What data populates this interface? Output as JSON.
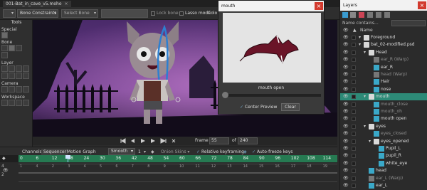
{
  "document_tab": {
    "title": "001-Bat_in_cave_v5.moho",
    "close": "×"
  },
  "toolbar": {
    "bone_constraints": "Bone Constraints",
    "select_bone": "Select Bone",
    "lock_bone": "Lock bone",
    "lasso_mode": "Lasso mode",
    "color_label": "Colo"
  },
  "tools": {
    "title": "Tools",
    "sections": [
      "Special",
      "Bone",
      "Layer",
      "Camera",
      "Workspace"
    ]
  },
  "preview_window": {
    "title": "mouth",
    "close": "×",
    "caption": "mouth open",
    "center_preview": "Center Preview",
    "clear": "Clear"
  },
  "playbar": {
    "frame_label": "Frame",
    "frame_value": "55",
    "of_label": "of",
    "total_frames": "240"
  },
  "timeline": {
    "tabs": [
      "Channels",
      "Sequencer",
      "Motion Graph"
    ],
    "interp": "Smooth",
    "step": "1",
    "onion_skins": "Onion Skins",
    "relative_keyframing": "Relative keyframing",
    "auto_freeze": "Auto-freeze keys",
    "ruler_ticks": [
      "0",
      "6",
      "12",
      "18",
      "24",
      "30",
      "36",
      "42",
      "48",
      "54",
      "60",
      "66",
      "72",
      "78",
      "84",
      "90",
      "96",
      "102",
      "108",
      "114"
    ],
    "body_ticks": [
      "1",
      "4",
      "2",
      "3",
      "4",
      "5",
      "6",
      "7",
      "8",
      "9",
      "10",
      "11",
      "12",
      "13",
      "14",
      "15",
      "16",
      "17",
      "18",
      "19"
    ],
    "row_labels": [
      "4",
      "2"
    ]
  },
  "layers": {
    "title": "Layers",
    "close": "×",
    "search_placeholder": "Name contains...",
    "name_header": "Name",
    "rows": [
      {
        "label": "Foreground",
        "indent": 0,
        "icon": "folder",
        "dim": false,
        "selected": false
      },
      {
        "label": "bat_02-modified.psd",
        "indent": 0,
        "icon": "folder",
        "dim": false,
        "selected": false
      },
      {
        "label": "Head",
        "indent": 1,
        "icon": "folder",
        "dim": false,
        "selected": false
      },
      {
        "label": "ear_R (Warp)",
        "indent": 2,
        "icon": "grp",
        "dim": true,
        "selected": false
      },
      {
        "label": "ear_R",
        "indent": 2,
        "icon": "img",
        "dim": false,
        "selected": false
      },
      {
        "label": "head (Warp)",
        "indent": 2,
        "icon": "grp",
        "dim": true,
        "selected": false
      },
      {
        "label": "Hair",
        "indent": 2,
        "icon": "img",
        "dim": false,
        "selected": false
      },
      {
        "label": "nose",
        "indent": 2,
        "icon": "img",
        "dim": false,
        "selected": false
      },
      {
        "label": "mouth",
        "indent": 1,
        "icon": "folder",
        "dim": false,
        "selected": true
      },
      {
        "label": "mouth_close",
        "indent": 2,
        "icon": "img",
        "dim": true,
        "selected": false
      },
      {
        "label": "mouth_oh",
        "indent": 2,
        "icon": "img",
        "dim": true,
        "selected": false
      },
      {
        "label": "mouth open",
        "indent": 2,
        "icon": "img",
        "dim": false,
        "selected": false
      },
      {
        "label": "eyes",
        "indent": 1,
        "icon": "folder",
        "dim": false,
        "selected": false
      },
      {
        "label": "eyes_closed",
        "indent": 2,
        "icon": "img",
        "dim": true,
        "selected": false
      },
      {
        "label": "eyes_opened",
        "indent": 2,
        "icon": "folder",
        "dim": false,
        "selected": false
      },
      {
        "label": "Pupil_L",
        "indent": 3,
        "icon": "img",
        "dim": false,
        "selected": false
      },
      {
        "label": "pupil_R",
        "indent": 3,
        "icon": "img",
        "dim": false,
        "selected": false
      },
      {
        "label": "white_eye",
        "indent": 3,
        "icon": "img",
        "dim": false,
        "selected": false
      },
      {
        "label": "head",
        "indent": 1,
        "icon": "img",
        "dim": false,
        "selected": false
      },
      {
        "label": "ear_L (Warp)",
        "indent": 1,
        "icon": "grp",
        "dim": true,
        "selected": false
      },
      {
        "label": "ear_L",
        "indent": 1,
        "icon": "img",
        "dim": false,
        "selected": false
      }
    ]
  }
}
